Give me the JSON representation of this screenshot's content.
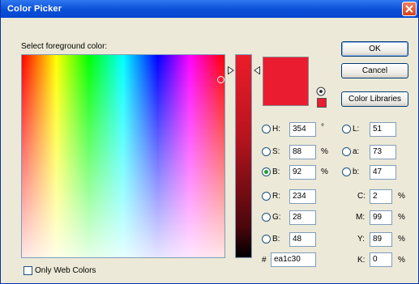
{
  "window": {
    "title": "Color Picker"
  },
  "prompt": "Select foreground color:",
  "buttons": {
    "ok": "OK",
    "cancel": "Cancel",
    "libraries": "Color Libraries"
  },
  "colors": {
    "current": "#ea1c30",
    "accent_title": "#0a4fd8"
  },
  "hsb": {
    "h": {
      "label": "H:",
      "value": "354",
      "unit": "°"
    },
    "s": {
      "label": "S:",
      "value": "88",
      "unit": "%"
    },
    "b": {
      "label": "B:",
      "value": "92",
      "unit": "%"
    }
  },
  "rgb": {
    "r": {
      "label": "R:",
      "value": "234"
    },
    "g": {
      "label": "G:",
      "value": "28"
    },
    "b": {
      "label": "B:",
      "value": "48"
    }
  },
  "lab": {
    "l": {
      "label": "L:",
      "value": "51"
    },
    "a": {
      "label": "a:",
      "value": "73"
    },
    "b": {
      "label": "b:",
      "value": "47"
    }
  },
  "cmyk": {
    "c": {
      "label": "C:",
      "value": "2",
      "unit": "%"
    },
    "m": {
      "label": "M:",
      "value": "99",
      "unit": "%"
    },
    "y": {
      "label": "Y:",
      "value": "89",
      "unit": "%"
    },
    "k": {
      "label": "K:",
      "value": "0",
      "unit": "%"
    }
  },
  "hex": {
    "label": "#",
    "value": "ea1c30"
  },
  "web_colors": {
    "label": "Only Web Colors",
    "checked": false
  },
  "selected_channel": "B",
  "icons": {
    "close": "close-icon",
    "gamut": "gamut-warning-icon",
    "slider": "slider-arrow-icon"
  }
}
